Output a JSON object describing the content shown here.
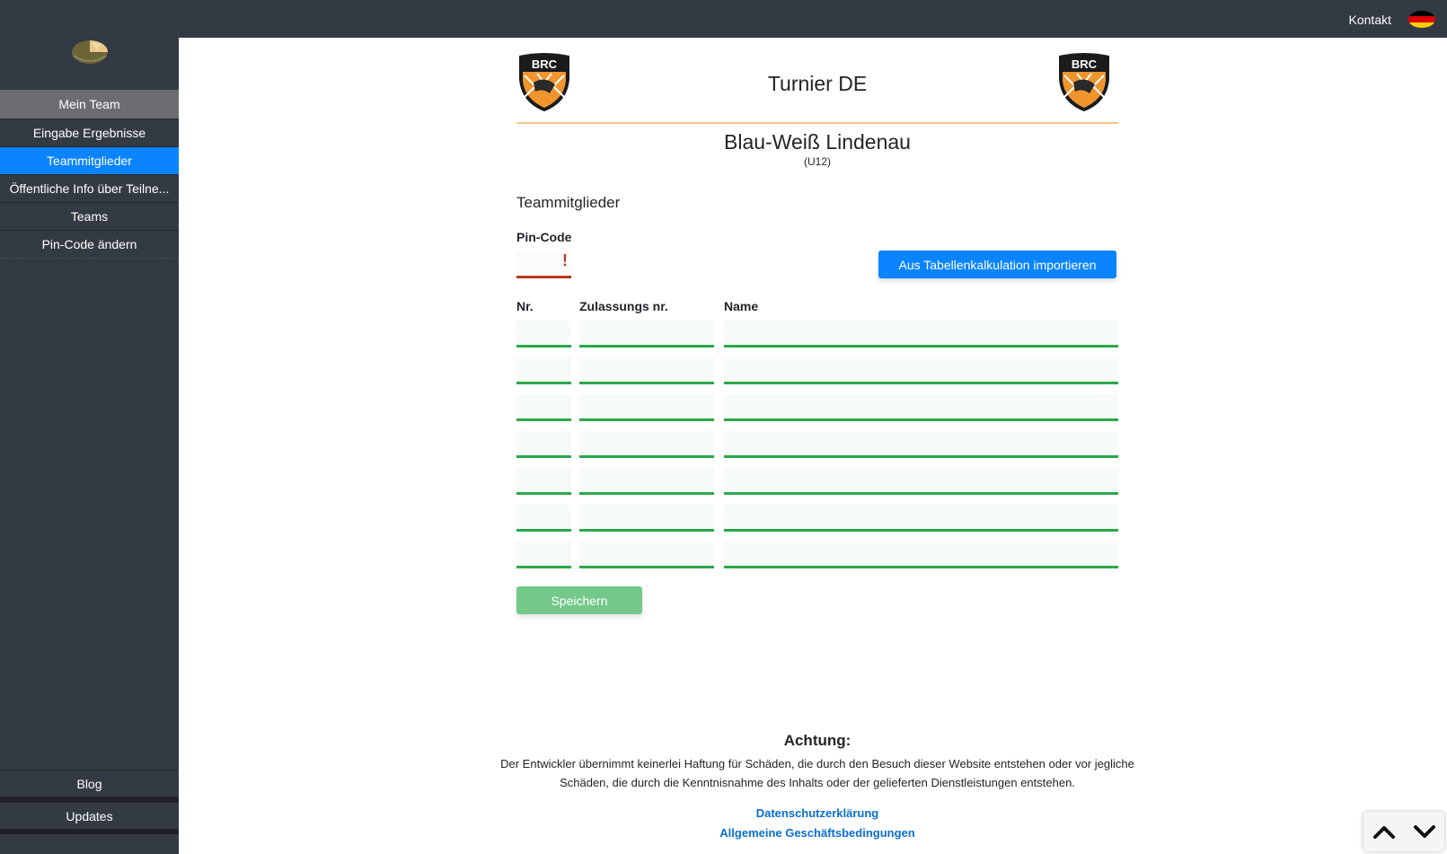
{
  "topbar": {
    "contact_label": "Kontakt",
    "language_flag_icon": "german-flag-icon",
    "flag_colors": [
      "#000000",
      "#dd0000",
      "#ffce00"
    ]
  },
  "sidebar": {
    "items": [
      {
        "label": "Mein Team"
      },
      {
        "label": "Eingabe Ergebnisse"
      },
      {
        "label": "Teammitglieder",
        "active": true
      },
      {
        "label": "Öffentliche Info über Teilne..."
      },
      {
        "label": "Teams"
      },
      {
        "label": "Pin-Code ändern"
      }
    ],
    "bottom_items": [
      {
        "label": "Blog"
      },
      {
        "label": "Updates"
      }
    ]
  },
  "header": {
    "title": "Turnier DE",
    "logo_text": "BRC"
  },
  "team": {
    "name": "Blau-Weiß Lindenau",
    "category": "(U12)"
  },
  "form": {
    "section_title": "Teammitglieder",
    "pin_label": "Pin-Code",
    "pin_value": "",
    "pin_error_mark": "!",
    "import_button": "Aus Tabellenkalkulation importieren",
    "columns": [
      "Nr.",
      "Zulassungs nr.",
      "Name"
    ],
    "rows": [
      {
        "nr": "",
        "zulassung": "",
        "name": ""
      },
      {
        "nr": "",
        "zulassung": "",
        "name": ""
      },
      {
        "nr": "",
        "zulassung": "",
        "name": ""
      },
      {
        "nr": "",
        "zulassung": "",
        "name": ""
      },
      {
        "nr": "",
        "zulassung": "",
        "name": ""
      },
      {
        "nr": "",
        "zulassung": "",
        "name": ""
      },
      {
        "nr": "",
        "zulassung": "",
        "name": ""
      }
    ],
    "save_button": "Speichern"
  },
  "footer": {
    "heading": "Achtung:",
    "disclaimer_line1": "Der Entwickler übernimmt keinerlei Haftung für Schäden, die durch den Besuch dieser Website entstehen oder vor jegliche",
    "disclaimer_line2": "Schäden, die durch die Kenntnisnahme des Inhalts oder der gelieferten Dienstleistungen entstehen.",
    "privacy_link": "Datenschutzerklärung",
    "terms_link": "Allgemeine Geschäftsbedingungen"
  },
  "colors": {
    "sidebar_bg": "#343a44",
    "accent_blue": "#0a84ff",
    "input_green": "#2aa84a",
    "error_red": "#b53a1e",
    "crest_orange": "#f0952e"
  }
}
